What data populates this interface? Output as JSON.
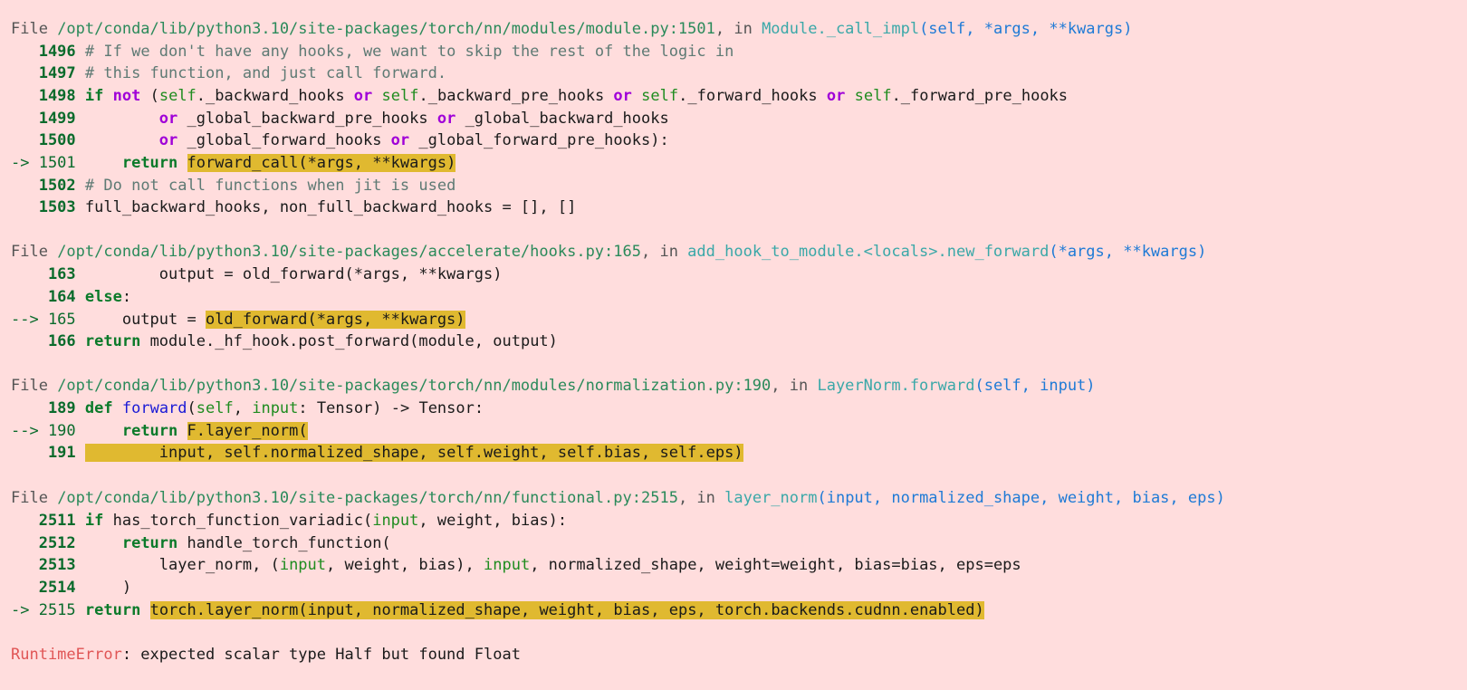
{
  "frames": [
    {
      "header": {
        "prefix": "File ",
        "path": "/opt/conda/lib/python3.10/site-packages/torch/nn/modules/module.py:1501",
        "mid": ", in ",
        "func": "Module._call_impl",
        "sig": "(self, *args, **kwargs)"
      },
      "lines": [
        {
          "gutter": "   1496",
          "segments": [
            {
              "t": " ",
              "c": ""
            },
            {
              "t": "# If we don't have any hooks, we want to skip the rest of the logic in",
              "c": "cm"
            }
          ]
        },
        {
          "gutter": "   1497",
          "segments": [
            {
              "t": " ",
              "c": ""
            },
            {
              "t": "# this function, and just call forward.",
              "c": "cm"
            }
          ]
        },
        {
          "gutter": "   1498",
          "segments": [
            {
              "t": " ",
              "c": ""
            },
            {
              "t": "if",
              "c": "kw"
            },
            {
              "t": " ",
              "c": ""
            },
            {
              "t": "not",
              "c": "kw2"
            },
            {
              "t": " (",
              "c": ""
            },
            {
              "t": "self",
              "c": "bi"
            },
            {
              "t": "._backward_hooks ",
              "c": ""
            },
            {
              "t": "or",
              "c": "kw2"
            },
            {
              "t": " ",
              "c": ""
            },
            {
              "t": "self",
              "c": "bi"
            },
            {
              "t": "._backward_pre_hooks ",
              "c": ""
            },
            {
              "t": "or",
              "c": "kw2"
            },
            {
              "t": " ",
              "c": ""
            },
            {
              "t": "self",
              "c": "bi"
            },
            {
              "t": "._forward_hooks ",
              "c": ""
            },
            {
              "t": "or",
              "c": "kw2"
            },
            {
              "t": " ",
              "c": ""
            },
            {
              "t": "self",
              "c": "bi"
            },
            {
              "t": "._forward_pre_hooks",
              "c": ""
            }
          ]
        },
        {
          "gutter": "   1499",
          "segments": [
            {
              "t": "         ",
              "c": ""
            },
            {
              "t": "or",
              "c": "kw2"
            },
            {
              "t": " _global_backward_pre_hooks ",
              "c": ""
            },
            {
              "t": "or",
              "c": "kw2"
            },
            {
              "t": " _global_backward_hooks",
              "c": ""
            }
          ]
        },
        {
          "gutter": "   1500",
          "segments": [
            {
              "t": "         ",
              "c": ""
            },
            {
              "t": "or",
              "c": "kw2"
            },
            {
              "t": " _global_forward_hooks ",
              "c": ""
            },
            {
              "t": "or",
              "c": "kw2"
            },
            {
              "t": " _global_forward_pre_hooks):",
              "c": ""
            }
          ]
        },
        {
          "gutter": "-> 1501",
          "current": true,
          "segments": [
            {
              "t": "     ",
              "c": ""
            },
            {
              "t": "return",
              "c": "kw"
            },
            {
              "t": " ",
              "c": ""
            },
            {
              "t": "forward_call(*args, **kwargs)",
              "c": "hl"
            }
          ]
        },
        {
          "gutter": "   1502",
          "segments": [
            {
              "t": " ",
              "c": ""
            },
            {
              "t": "# Do not call functions when jit is used",
              "c": "cm"
            }
          ]
        },
        {
          "gutter": "   1503",
          "segments": [
            {
              "t": " full_backward_hooks, non_full_backward_hooks = [], []",
              "c": ""
            }
          ]
        }
      ]
    },
    {
      "header": {
        "prefix": "File ",
        "path": "/opt/conda/lib/python3.10/site-packages/accelerate/hooks.py:165",
        "mid": ", in ",
        "func": "add_hook_to_module.<locals>.new_forward",
        "sig": "(*args, **kwargs)"
      },
      "lines": [
        {
          "gutter": "    163",
          "segments": [
            {
              "t": "         output = old_forward(*args, **kwargs)",
              "c": ""
            }
          ]
        },
        {
          "gutter": "    164",
          "segments": [
            {
              "t": " ",
              "c": ""
            },
            {
              "t": "else",
              "c": "kw"
            },
            {
              "t": ":",
              "c": ""
            }
          ]
        },
        {
          "gutter": "--> 165",
          "current": true,
          "segments": [
            {
              "t": "     output = ",
              "c": ""
            },
            {
              "t": "old_forward(*args, **kwargs)",
              "c": "hl"
            }
          ]
        },
        {
          "gutter": "    166",
          "segments": [
            {
              "t": " ",
              "c": ""
            },
            {
              "t": "return",
              "c": "kw"
            },
            {
              "t": " module._hf_hook.post_forward(module, output)",
              "c": ""
            }
          ]
        }
      ]
    },
    {
      "header": {
        "prefix": "File ",
        "path": "/opt/conda/lib/python3.10/site-packages/torch/nn/modules/normalization.py:190",
        "mid": ", in ",
        "func": "LayerNorm.forward",
        "sig": "(self, input)"
      },
      "lines": [
        {
          "gutter": "    189",
          "segments": [
            {
              "t": " ",
              "c": ""
            },
            {
              "t": "def",
              "c": "kw"
            },
            {
              "t": " ",
              "c": ""
            },
            {
              "t": "forward",
              "c": "def"
            },
            {
              "t": "(",
              "c": ""
            },
            {
              "t": "self",
              "c": "bi"
            },
            {
              "t": ", ",
              "c": ""
            },
            {
              "t": "input",
              "c": "bi"
            },
            {
              "t": ": Tensor) -> Tensor:",
              "c": ""
            }
          ]
        },
        {
          "gutter": "--> 190",
          "current": true,
          "segments": [
            {
              "t": "     ",
              "c": ""
            },
            {
              "t": "return",
              "c": "kw"
            },
            {
              "t": " ",
              "c": ""
            },
            {
              "t": "F.layer_norm(",
              "c": "hl"
            }
          ]
        },
        {
          "gutter": "    191",
          "segments": [
            {
              "t": " ",
              "c": ""
            },
            {
              "t": "        input, self.normalized_shape, self.weight, self.bias, self.eps)",
              "c": "hl"
            }
          ]
        }
      ]
    },
    {
      "header": {
        "prefix": "File ",
        "path": "/opt/conda/lib/python3.10/site-packages/torch/nn/functional.py:2515",
        "mid": ", in ",
        "func": "layer_norm",
        "sig": "(input, normalized_shape, weight, bias, eps)"
      },
      "lines": [
        {
          "gutter": "   2511",
          "segments": [
            {
              "t": " ",
              "c": ""
            },
            {
              "t": "if",
              "c": "kw"
            },
            {
              "t": " has_torch_function_variadic(",
              "c": ""
            },
            {
              "t": "input",
              "c": "bi"
            },
            {
              "t": ", weight, bias):",
              "c": ""
            }
          ]
        },
        {
          "gutter": "   2512",
          "segments": [
            {
              "t": "     ",
              "c": ""
            },
            {
              "t": "return",
              "c": "kw"
            },
            {
              "t": " handle_torch_function(",
              "c": ""
            }
          ]
        },
        {
          "gutter": "   2513",
          "segments": [
            {
              "t": "         layer_norm, (",
              "c": ""
            },
            {
              "t": "input",
              "c": "bi"
            },
            {
              "t": ", weight, bias), ",
              "c": ""
            },
            {
              "t": "input",
              "c": "bi"
            },
            {
              "t": ", normalized_shape, weight=weight, bias=bias, eps=eps",
              "c": ""
            }
          ]
        },
        {
          "gutter": "   2514",
          "segments": [
            {
              "t": "     )",
              "c": ""
            }
          ]
        },
        {
          "gutter": "-> 2515",
          "current": true,
          "segments": [
            {
              "t": " ",
              "c": ""
            },
            {
              "t": "return",
              "c": "kw"
            },
            {
              "t": " ",
              "c": ""
            },
            {
              "t": "torch.layer_norm(input, normalized_shape, weight, bias, eps, torch.backends.cudnn.enabled)",
              "c": "hl"
            }
          ]
        }
      ]
    }
  ],
  "error": {
    "type": "RuntimeError",
    "message": ": expected scalar type Half but found Float"
  },
  "colors": {
    "background": "#ffdddd",
    "highlight": "#e0b930",
    "error": "#e05555",
    "keyword": "#0b7a2a",
    "operator_keyword": "#a000d8"
  }
}
